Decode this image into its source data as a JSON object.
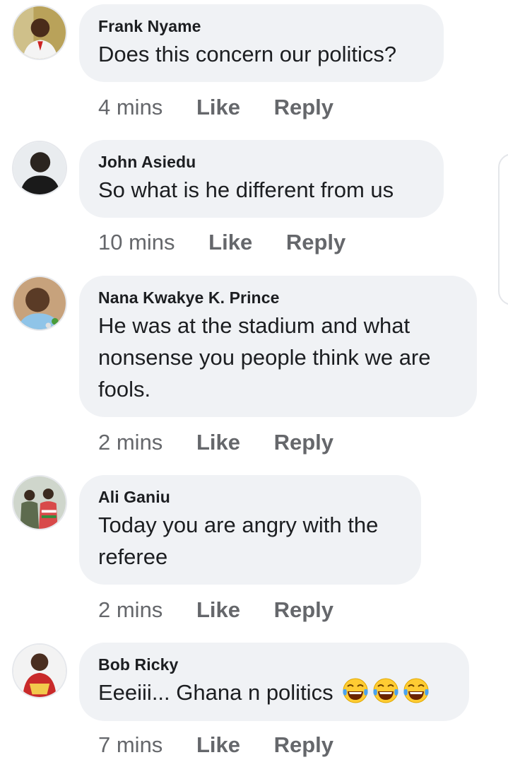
{
  "comments": [
    {
      "author": "Frank Nyame",
      "text": "Does this concern our politics?",
      "time": "4 mins",
      "like_label": "Like",
      "reply_label": "Reply"
    },
    {
      "author": "John Asiedu",
      "text": "So what is he different from us",
      "time": "10 mins",
      "like_label": "Like",
      "reply_label": "Reply"
    },
    {
      "author": "Nana Kwakye K. Prince",
      "text": "He was at the stadium and what nonsense you people think we are fools.",
      "time": "2 mins",
      "like_label": "Like",
      "reply_label": "Reply"
    },
    {
      "author": "Ali Ganiu",
      "text": "Today you are angry with the referee",
      "time": "2 mins",
      "like_label": "Like",
      "reply_label": "Reply"
    },
    {
      "author": "Bob Ricky",
      "text": "Eeeiii... Ghana n politics",
      "emojis": [
        "face-with-tears-of-joy-icon",
        "face-with-tears-of-joy-icon",
        "face-with-tears-of-joy-icon"
      ],
      "time": "7 mins",
      "like_label": "Like",
      "reply_label": "Reply"
    }
  ],
  "colors": {
    "bubble": "#f0f2f5",
    "meta_text": "#65676b",
    "author_text": "#1c1e21"
  }
}
